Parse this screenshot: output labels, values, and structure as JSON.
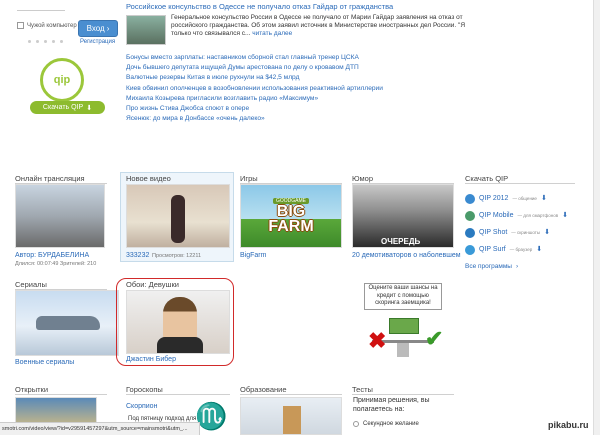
{
  "login": {
    "remember_label": "Чужой компьютер",
    "login_button": "Вход",
    "register_link": "Регистрация"
  },
  "qip_promo": {
    "logo_text": "qip",
    "download_button": "Скачать QIP"
  },
  "news": {
    "headline": "Российское консульство в Одессе не получало отказ Гайдар от гражданства",
    "lead": "Генеральное консульство России в Одессе не получало от Марии Гайдар заявления на отказ от российского гражданства. Об этом заявил источник в Министерстве иностранных дел России. \"Я только что связывался с...",
    "read_more": "читать далее",
    "items": [
      "Бонусы вместо зарплаты: наставником сборной стал главный тренер ЦСКА",
      "Дочь бывшего депутата ищущей Думы арестована по делу о кровавом ДТП",
      "Валютные резервы Китая в июле рухнули на $42,5 млрд",
      "Киев обвинил ополченцев в возобновлении использования реактивной артиллерии",
      "Михаила Козырева пригласили возглавить радио «Максимум»",
      "Про жизнь Стива Джобса споют в опере",
      "Ясенюк: до мира в Донбассе «очень далеко»"
    ]
  },
  "sections": {
    "online": {
      "title": "Онлайн трансляция",
      "author": "Автор: БУРДАБЕЛИНА",
      "meta": "Длился: 00:07:49  Зрителей: 210"
    },
    "new_video": {
      "title": "Новое видео",
      "views_count": "333232",
      "views_label": "Просмотров: 12211"
    },
    "games": {
      "title": "Игры",
      "game_logo_top": "BIG",
      "game_logo_bottom": "FARM",
      "badge": "GOODGAME",
      "caption": "BigFarm"
    },
    "humor": {
      "title": "Юмор",
      "image_text": "ОЧЕРЕДЬ",
      "caption": "20 демотиваторов о наболевшем"
    },
    "download_qip": {
      "title": "Скачать QIP",
      "items": [
        {
          "name": "QIP 2012",
          "sub": "— общение",
          "color": "#3a8ad0"
        },
        {
          "name": "QIP Mobile",
          "sub": "— для смартфонов",
          "color": "#4a9a6a"
        },
        {
          "name": "QIP Shot",
          "sub": "— скриншоты",
          "color": "#2a7ac0"
        },
        {
          "name": "QIP Surf",
          "sub": "— браузер",
          "color": "#3a9ad8"
        }
      ],
      "all_programs": "Все программы"
    },
    "serials": {
      "title": "Сериалы",
      "caption": "Военные сериалы"
    },
    "wallpapers": {
      "title": "Обои: Девушки",
      "caption": "Джастин Бибер"
    },
    "credit_ad": {
      "text": "Оцените ваши шансы на кредит с помощью скоринга заемщика!"
    },
    "postcards": {
      "title": "Открытки"
    },
    "horoscopes": {
      "title": "Гороскопы",
      "sign": "Скорпион",
      "desc": "Под пятницу подход для"
    },
    "education": {
      "title": "Образование"
    },
    "tests": {
      "title": "Тесты",
      "question": "Принимая решения, вы полагаетесь на:",
      "option1": "Секундное желание"
    }
  },
  "status_bar": "smotri.com/video/view/?id=v29591457297&utm_source=mainsmotri&utm_...",
  "watermark": "pikabu.ru"
}
